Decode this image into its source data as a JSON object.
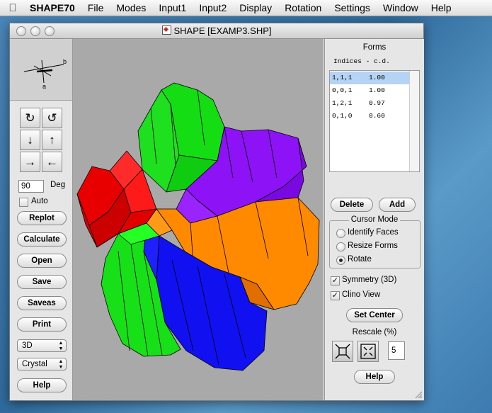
{
  "menubar": {
    "app": "SHAPE70",
    "items": [
      "File",
      "Modes",
      "Input1",
      "Input2",
      "Display",
      "Rotation",
      "Settings",
      "Window",
      "Help"
    ]
  },
  "window": {
    "title": "SHAPE [EXAMP3.SHP]"
  },
  "left": {
    "angle_value": "90",
    "angle_unit": "Deg",
    "auto_label": "Auto",
    "buttons": [
      "Replot",
      "Calculate",
      "Open",
      "Save",
      "Saveas",
      "Print"
    ],
    "display_select": "3D",
    "mode_select": "Crystal",
    "help": "Help"
  },
  "axes": {
    "label_b": "b",
    "label_a": "a"
  },
  "right": {
    "forms_title": "Forms",
    "forms_header": "Indices - c.d.",
    "forms": [
      {
        "idx": "1,1,1",
        "cd": "1.00"
      },
      {
        "idx": "0,0,1",
        "cd": "1.00"
      },
      {
        "idx": "1,2,1",
        "cd": "0.97"
      },
      {
        "idx": "0,1,0",
        "cd": "0.60"
      }
    ],
    "delete": "Delete",
    "add": "Add",
    "cursor_mode_title": "Cursor Mode",
    "cursor_modes": [
      "Identify Faces",
      "Resize Forms",
      "Rotate"
    ],
    "symmetry": "Symmetry (3D)",
    "clino": "Clino View",
    "set_center": "Set Center",
    "rescale": "Rescale (%)",
    "rescale_value": "5",
    "help": "Help"
  },
  "colors": {
    "selection": "#b5d3f5",
    "red": "#e00000",
    "green": "#14e014",
    "blue": "#1010f0",
    "purple": "#8a12f0",
    "orange": "#ff8a00"
  }
}
